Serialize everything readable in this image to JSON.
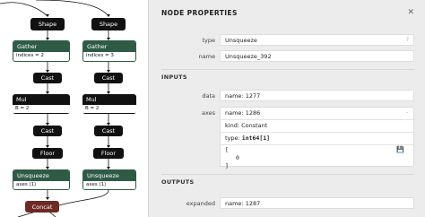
{
  "graph": {
    "nodes": {
      "shape_left": "Shape",
      "shape_right": "Shape",
      "gather_left": {
        "title": "Gather",
        "attr": "indices = 2"
      },
      "gather_right": {
        "title": "Gather",
        "attr": "indices = 3"
      },
      "cast_left_1": "Cast",
      "cast_right_1": "Cast",
      "mul_left": {
        "title": "Mul",
        "attr": "B = 2"
      },
      "mul_right": {
        "title": "Mul",
        "attr": "B = 2"
      },
      "cast_left_2": "Cast",
      "cast_right_2": "Cast",
      "floor_left": "Floor",
      "floor_right": "Floor",
      "unsq_left": {
        "title": "Unsqueeze",
        "attr": "axes ⟨1⟩"
      },
      "unsq_right": {
        "title": "Unsqueeze",
        "attr": "axes ⟨1⟩"
      },
      "concat": "Concat"
    }
  },
  "panel": {
    "title": "NODE PROPERTIES",
    "type_label": "type",
    "type_value": "Unsqueeze",
    "type_help": "?",
    "name_label": "name",
    "name_value": "Unsqueeze_392",
    "inputs_header": "INPUTS",
    "data_label": "data",
    "data_value": "name: 1277",
    "axes_label": "axes",
    "axes_name": "name: 1286",
    "axes_kind": "kind: Constant",
    "axes_type_prefix": "type: ",
    "axes_type_value": "int64[1]",
    "axes_tensor_open": "[",
    "axes_tensor_value": "0",
    "axes_tensor_close": "]",
    "axes_collapse": "-",
    "outputs_header": "OUTPUTS",
    "expanded_label": "expanded",
    "expanded_value": "name: 1287"
  },
  "colors": {
    "gather_header": "#2f5b46",
    "concat": "#6e2b24",
    "op_node": "#111111"
  }
}
